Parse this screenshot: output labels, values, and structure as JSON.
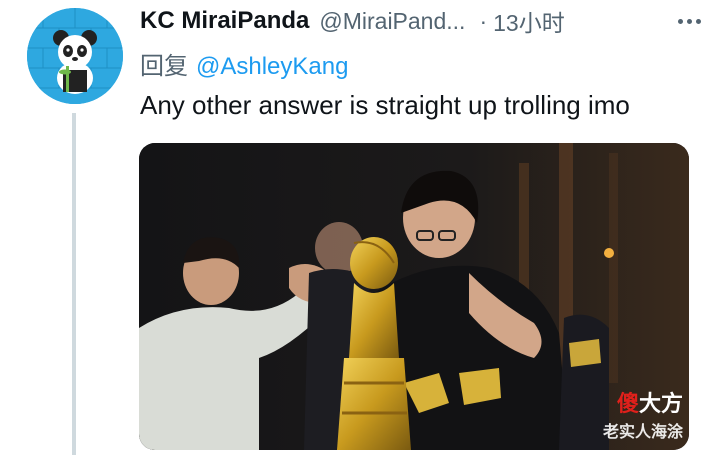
{
  "tweet": {
    "author": {
      "display_name": "KC MiraiPanda",
      "handle": "@MiraiPand...",
      "avatar_icon": "panda-avatar-icon"
    },
    "separator": "·",
    "timestamp": "13小时",
    "more_icon": "more-options-icon",
    "reply": {
      "prefix": "回复",
      "mention": "@AshleyKang"
    },
    "text": "Any other answer is straight up trolling imo",
    "media": {
      "watermark_brand": [
        "傻",
        "大方"
      ],
      "watermark_caption": "老实人海涂"
    }
  },
  "colors": {
    "avatar_bg": "#2ea8e0",
    "link": "#1d9bf0",
    "secondary_text": "#536471",
    "primary_text": "#0f1419",
    "thread_line": "#cfd9de",
    "watermark_red": "#e0201b"
  }
}
